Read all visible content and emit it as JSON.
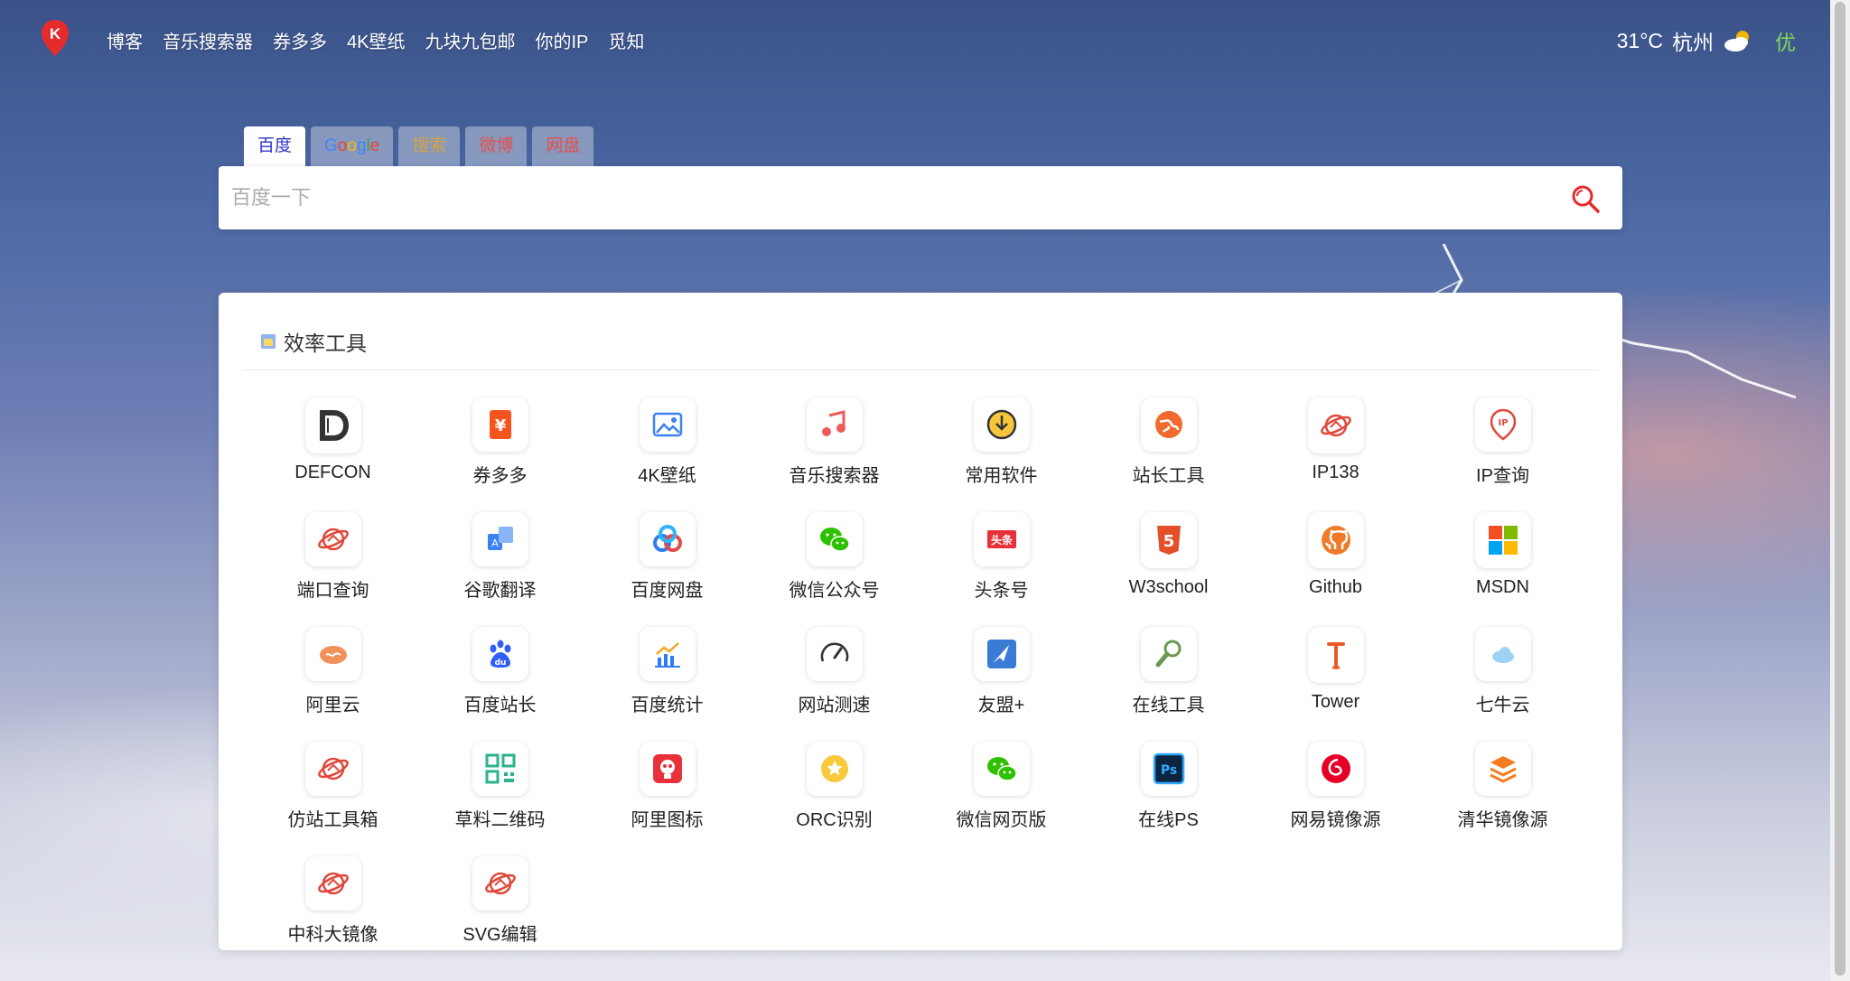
{
  "nav": {
    "links": [
      "博客",
      "音乐搜索器",
      "券多多",
      "4K壁纸",
      "九块九包邮",
      "你的IP",
      "觅知"
    ]
  },
  "weather": {
    "temp": "31°C",
    "city": "杭州",
    "aqi": "优",
    "icon": "partly-cloudy-icon"
  },
  "search": {
    "tabs": [
      "百度",
      "Google",
      "搜索",
      "微博",
      "网盘"
    ],
    "active_tab": "百度",
    "placeholder": "百度一下"
  },
  "card": {
    "title": "效率工具",
    "items": [
      {
        "label": "DEFCON",
        "icon": "defcon-icon"
      },
      {
        "label": "券多多",
        "icon": "coupon-icon"
      },
      {
        "label": "4K壁纸",
        "icon": "image-icon"
      },
      {
        "label": "音乐搜索器",
        "icon": "music-icon"
      },
      {
        "label": "常用软件",
        "icon": "download-icon"
      },
      {
        "label": "站长工具",
        "icon": "globe-icon"
      },
      {
        "label": "IP138",
        "icon": "planet-icon"
      },
      {
        "label": "IP查询",
        "icon": "ip-pin-icon"
      },
      {
        "label": "端口查询",
        "icon": "planet-icon"
      },
      {
        "label": "谷歌翻译",
        "icon": "translate-icon"
      },
      {
        "label": "百度网盘",
        "icon": "baidu-pan-icon"
      },
      {
        "label": "微信公众号",
        "icon": "wechat-icon"
      },
      {
        "label": "头条号",
        "icon": "toutiao-icon"
      },
      {
        "label": "W3school",
        "icon": "html5-icon"
      },
      {
        "label": "Github",
        "icon": "github-icon"
      },
      {
        "label": "MSDN",
        "icon": "windows-icon"
      },
      {
        "label": "阿里云",
        "icon": "aliyun-icon"
      },
      {
        "label": "百度站长",
        "icon": "baidu-paw-icon"
      },
      {
        "label": "百度统计",
        "icon": "chart-icon"
      },
      {
        "label": "网站测速",
        "icon": "speedometer-icon"
      },
      {
        "label": "友盟+",
        "icon": "umeng-icon"
      },
      {
        "label": "在线工具",
        "icon": "tools-icon"
      },
      {
        "label": "Tower",
        "icon": "tower-icon"
      },
      {
        "label": "七牛云",
        "icon": "cloud-icon"
      },
      {
        "label": "仿站工具箱",
        "icon": "planet-icon"
      },
      {
        "label": "草料二维码",
        "icon": "qrcode-icon"
      },
      {
        "label": "阿里图标",
        "icon": "iconfont-icon"
      },
      {
        "label": "ORC识别",
        "icon": "star-icon"
      },
      {
        "label": "微信网页版",
        "icon": "wechat-icon"
      },
      {
        "label": "在线PS",
        "icon": "photoshop-icon"
      },
      {
        "label": "网易镜像源",
        "icon": "netease-icon"
      },
      {
        "label": "清华镜像源",
        "icon": "layers-icon"
      },
      {
        "label": "中科大镜像",
        "icon": "planet-icon"
      },
      {
        "label": "SVG编辑",
        "icon": "planet-icon"
      }
    ]
  }
}
